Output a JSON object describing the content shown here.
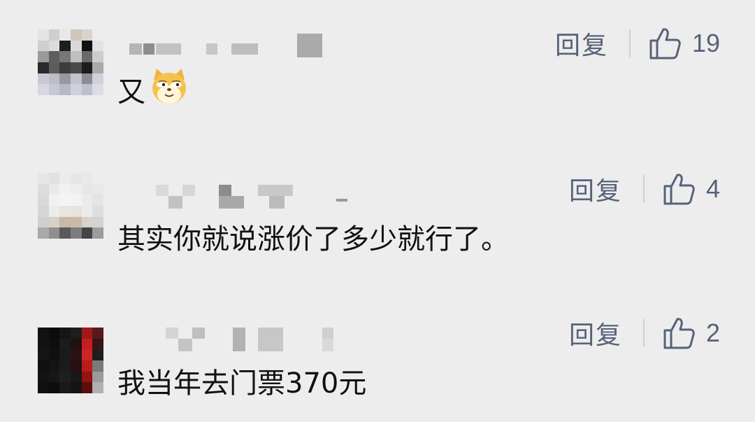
{
  "comments": [
    {
      "reply_label": "回复",
      "like_count": "19",
      "text": "又",
      "emoji": "doge-emoji"
    },
    {
      "reply_label": "回复",
      "like_count": "4",
      "text": "其实你就说涨价了多少就行了。"
    },
    {
      "reply_label": "回复",
      "like_count": "2",
      "text": "我当年去门票370元"
    }
  ],
  "icons": {
    "like": "thumbs-up-icon"
  },
  "colors": {
    "background": "#ededed",
    "action_text": "#56627a",
    "body_text": "#111111"
  }
}
